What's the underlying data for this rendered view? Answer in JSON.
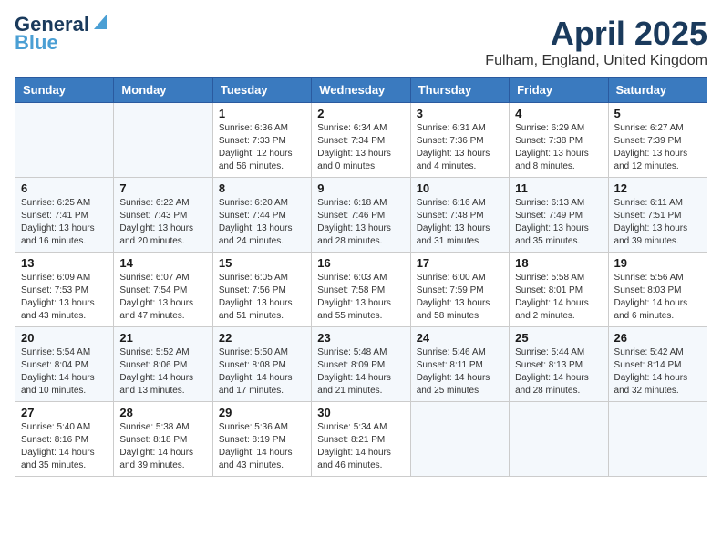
{
  "header": {
    "logo_general": "General",
    "logo_blue": "Blue",
    "title": "April 2025",
    "subtitle": "Fulham, England, United Kingdom"
  },
  "days_of_week": [
    "Sunday",
    "Monday",
    "Tuesday",
    "Wednesday",
    "Thursday",
    "Friday",
    "Saturday"
  ],
  "weeks": [
    [
      {
        "day": "",
        "info": ""
      },
      {
        "day": "",
        "info": ""
      },
      {
        "day": "1",
        "info": "Sunrise: 6:36 AM\nSunset: 7:33 PM\nDaylight: 12 hours\nand 56 minutes."
      },
      {
        "day": "2",
        "info": "Sunrise: 6:34 AM\nSunset: 7:34 PM\nDaylight: 13 hours\nand 0 minutes."
      },
      {
        "day": "3",
        "info": "Sunrise: 6:31 AM\nSunset: 7:36 PM\nDaylight: 13 hours\nand 4 minutes."
      },
      {
        "day": "4",
        "info": "Sunrise: 6:29 AM\nSunset: 7:38 PM\nDaylight: 13 hours\nand 8 minutes."
      },
      {
        "day": "5",
        "info": "Sunrise: 6:27 AM\nSunset: 7:39 PM\nDaylight: 13 hours\nand 12 minutes."
      }
    ],
    [
      {
        "day": "6",
        "info": "Sunrise: 6:25 AM\nSunset: 7:41 PM\nDaylight: 13 hours\nand 16 minutes."
      },
      {
        "day": "7",
        "info": "Sunrise: 6:22 AM\nSunset: 7:43 PM\nDaylight: 13 hours\nand 20 minutes."
      },
      {
        "day": "8",
        "info": "Sunrise: 6:20 AM\nSunset: 7:44 PM\nDaylight: 13 hours\nand 24 minutes."
      },
      {
        "day": "9",
        "info": "Sunrise: 6:18 AM\nSunset: 7:46 PM\nDaylight: 13 hours\nand 28 minutes."
      },
      {
        "day": "10",
        "info": "Sunrise: 6:16 AM\nSunset: 7:48 PM\nDaylight: 13 hours\nand 31 minutes."
      },
      {
        "day": "11",
        "info": "Sunrise: 6:13 AM\nSunset: 7:49 PM\nDaylight: 13 hours\nand 35 minutes."
      },
      {
        "day": "12",
        "info": "Sunrise: 6:11 AM\nSunset: 7:51 PM\nDaylight: 13 hours\nand 39 minutes."
      }
    ],
    [
      {
        "day": "13",
        "info": "Sunrise: 6:09 AM\nSunset: 7:53 PM\nDaylight: 13 hours\nand 43 minutes."
      },
      {
        "day": "14",
        "info": "Sunrise: 6:07 AM\nSunset: 7:54 PM\nDaylight: 13 hours\nand 47 minutes."
      },
      {
        "day": "15",
        "info": "Sunrise: 6:05 AM\nSunset: 7:56 PM\nDaylight: 13 hours\nand 51 minutes."
      },
      {
        "day": "16",
        "info": "Sunrise: 6:03 AM\nSunset: 7:58 PM\nDaylight: 13 hours\nand 55 minutes."
      },
      {
        "day": "17",
        "info": "Sunrise: 6:00 AM\nSunset: 7:59 PM\nDaylight: 13 hours\nand 58 minutes."
      },
      {
        "day": "18",
        "info": "Sunrise: 5:58 AM\nSunset: 8:01 PM\nDaylight: 14 hours\nand 2 minutes."
      },
      {
        "day": "19",
        "info": "Sunrise: 5:56 AM\nSunset: 8:03 PM\nDaylight: 14 hours\nand 6 minutes."
      }
    ],
    [
      {
        "day": "20",
        "info": "Sunrise: 5:54 AM\nSunset: 8:04 PM\nDaylight: 14 hours\nand 10 minutes."
      },
      {
        "day": "21",
        "info": "Sunrise: 5:52 AM\nSunset: 8:06 PM\nDaylight: 14 hours\nand 13 minutes."
      },
      {
        "day": "22",
        "info": "Sunrise: 5:50 AM\nSunset: 8:08 PM\nDaylight: 14 hours\nand 17 minutes."
      },
      {
        "day": "23",
        "info": "Sunrise: 5:48 AM\nSunset: 8:09 PM\nDaylight: 14 hours\nand 21 minutes."
      },
      {
        "day": "24",
        "info": "Sunrise: 5:46 AM\nSunset: 8:11 PM\nDaylight: 14 hours\nand 25 minutes."
      },
      {
        "day": "25",
        "info": "Sunrise: 5:44 AM\nSunset: 8:13 PM\nDaylight: 14 hours\nand 28 minutes."
      },
      {
        "day": "26",
        "info": "Sunrise: 5:42 AM\nSunset: 8:14 PM\nDaylight: 14 hours\nand 32 minutes."
      }
    ],
    [
      {
        "day": "27",
        "info": "Sunrise: 5:40 AM\nSunset: 8:16 PM\nDaylight: 14 hours\nand 35 minutes."
      },
      {
        "day": "28",
        "info": "Sunrise: 5:38 AM\nSunset: 8:18 PM\nDaylight: 14 hours\nand 39 minutes."
      },
      {
        "day": "29",
        "info": "Sunrise: 5:36 AM\nSunset: 8:19 PM\nDaylight: 14 hours\nand 43 minutes."
      },
      {
        "day": "30",
        "info": "Sunrise: 5:34 AM\nSunset: 8:21 PM\nDaylight: 14 hours\nand 46 minutes."
      },
      {
        "day": "",
        "info": ""
      },
      {
        "day": "",
        "info": ""
      },
      {
        "day": "",
        "info": ""
      }
    ]
  ]
}
